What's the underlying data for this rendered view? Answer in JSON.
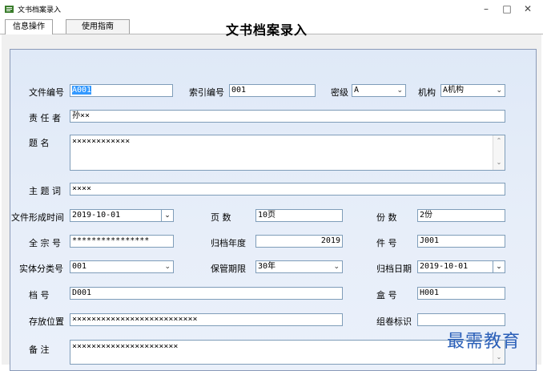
{
  "window": {
    "title": "文书档案录入",
    "minimize": "–",
    "maximize": "□",
    "close": "✕"
  },
  "tabs": [
    {
      "label": "信息操作"
    },
    {
      "label": "使用指南"
    }
  ],
  "form": {
    "title": "文书档案录入",
    "doc_no": {
      "label": "文件编号",
      "value": "A001"
    },
    "index_no": {
      "label": "索引编号",
      "value": "001"
    },
    "secret": {
      "label": "密级",
      "value": "A"
    },
    "org": {
      "label": "机构",
      "value": "A机构"
    },
    "owner": {
      "label": "责 任 者",
      "value": "孙××"
    },
    "title_field": {
      "label": "题    名",
      "value": "××××××××××××"
    },
    "subject": {
      "label": "主 题 词",
      "value": "××××"
    },
    "form_date": {
      "label": "文件形成时间",
      "value": "2019-10-01"
    },
    "pages": {
      "label": "页    数",
      "value": "10页"
    },
    "copies": {
      "label": "份    数",
      "value": "2份"
    },
    "fonds": {
      "label": "全 宗 号",
      "value": "****************"
    },
    "year": {
      "label": "归档年度",
      "value": "2019"
    },
    "piece": {
      "label": "件    号",
      "value": "J001"
    },
    "category": {
      "label": "实体分类号",
      "value": "001"
    },
    "retention": {
      "label": "保管期限",
      "value": "30年"
    },
    "archive_date": {
      "label": "归档日期",
      "value": "2019-10-01"
    },
    "file_no": {
      "label": "档    号",
      "value": "D001"
    },
    "box": {
      "label": "盒    号",
      "value": "H001"
    },
    "location": {
      "label": "存放位置",
      "value": "××××××××××××××××××××××××××"
    },
    "volume": {
      "label": "组卷标识",
      "value": ""
    },
    "remark": {
      "label": "备    注",
      "value": "××××××××××××××××××××××"
    }
  },
  "watermark": "最需教育",
  "colors": {
    "panel_bg": "#e2ebf8",
    "border": "#7f9db9",
    "selection": "#3399ff",
    "watermark": "#2a5fb8"
  }
}
